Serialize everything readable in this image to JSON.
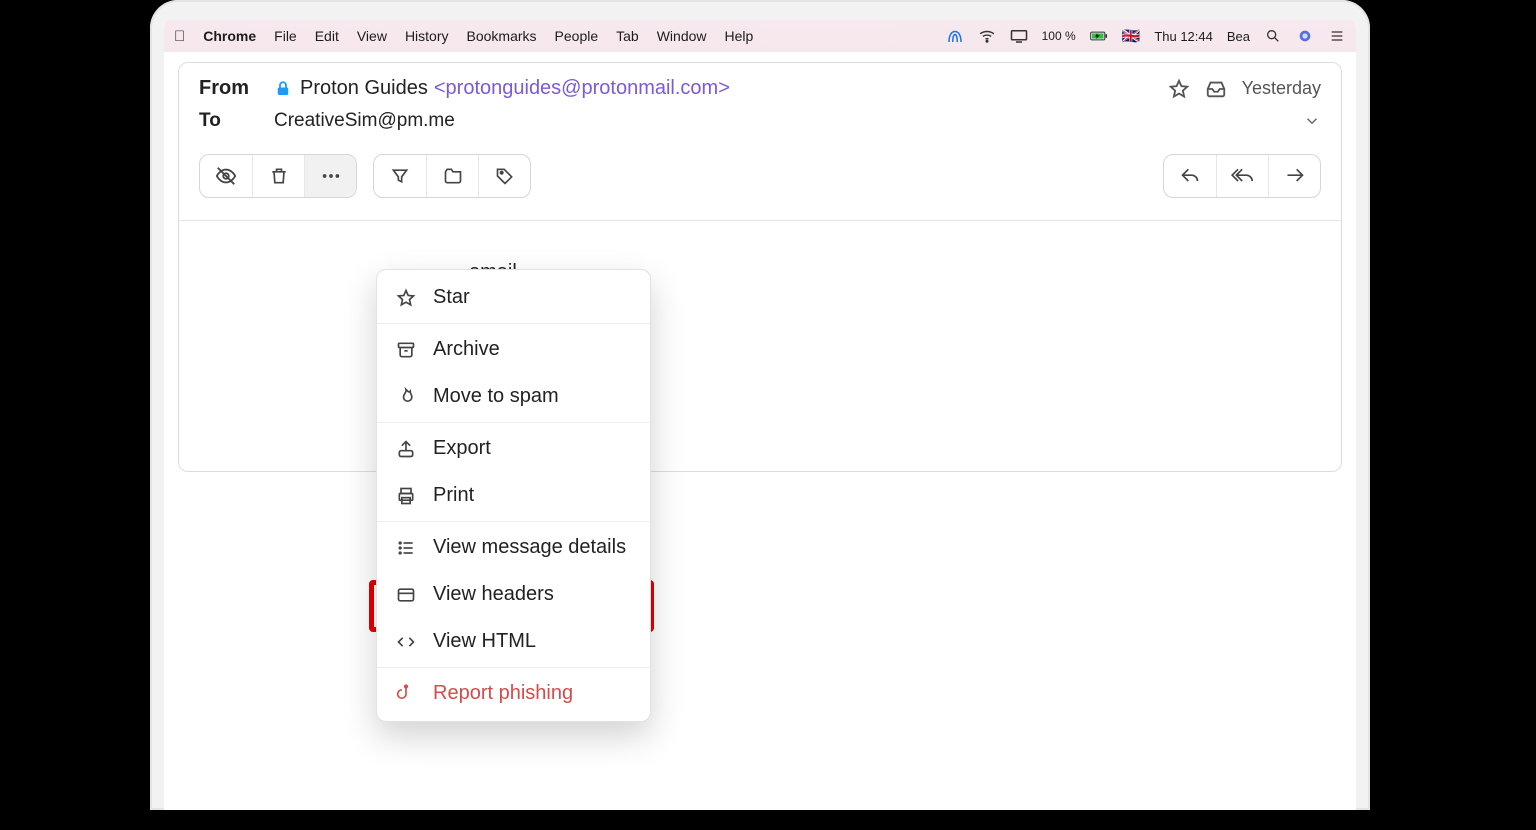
{
  "menubar": {
    "app": "Chrome",
    "items": [
      "File",
      "Edit",
      "View",
      "History",
      "Bookmarks",
      "People",
      "Tab",
      "Window",
      "Help"
    ],
    "battery": "100 %",
    "clock": "Thu 12:44",
    "user": "Bea"
  },
  "header": {
    "from_label": "From",
    "sender_name": "Proton Guides",
    "sender_email": "<protonguides@protonmail.com>",
    "to_label": "To",
    "recipient": "CreativeSim@pm.me",
    "date": "Yesterday"
  },
  "body": {
    "visible_text": "email."
  },
  "dropdown": {
    "star": "Star",
    "archive": "Archive",
    "spam": "Move to spam",
    "export": "Export",
    "print": "Print",
    "details": "View message details",
    "headers": "View headers",
    "html": "View HTML",
    "phish": "Report phishing"
  },
  "highlight": {
    "target": "view-headers"
  }
}
